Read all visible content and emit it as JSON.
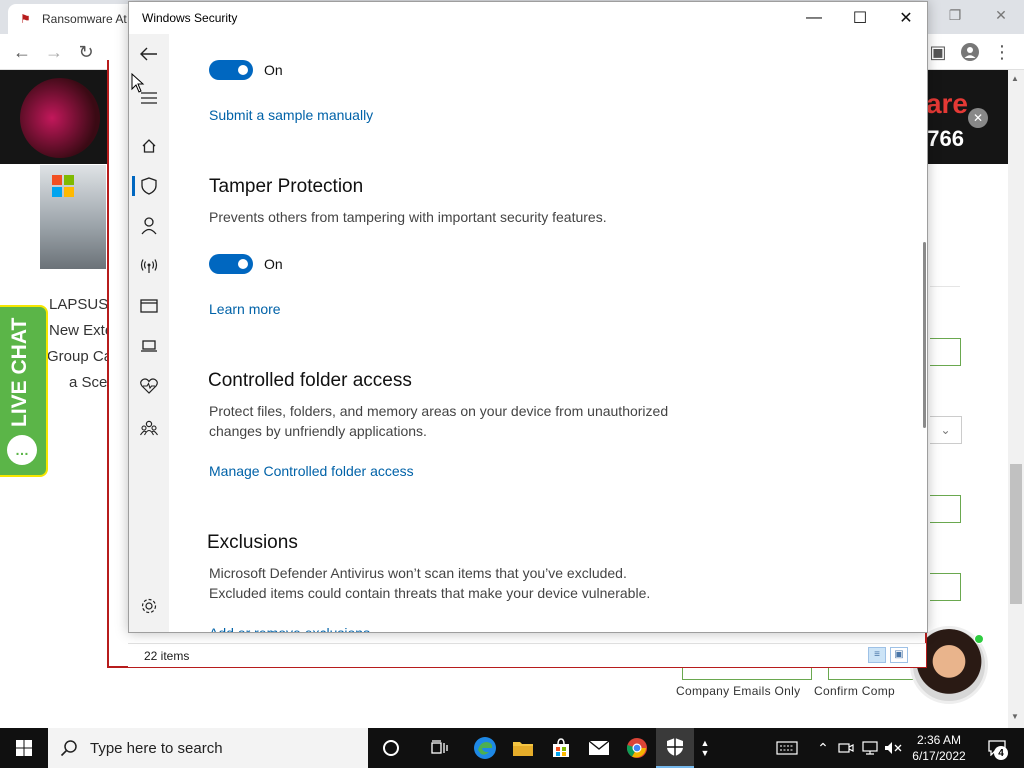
{
  "browser": {
    "tab_title": "Ransomware At",
    "banner_text": "are",
    "banner_number": "766",
    "article_lines": [
      "LAPSUS$",
      "New Exte",
      "Group Ca",
      "a Sce"
    ],
    "live_chat_label": "LIVE CHAT",
    "button_labels": [
      "Company Emails Only",
      "Confirm Comp"
    ]
  },
  "explorer": {
    "item_count": "22 items"
  },
  "security": {
    "window_title": "Windows Security",
    "toggle1_state": "On",
    "submit_sample_link": "Submit a sample manually",
    "tamper": {
      "title": "Tamper Protection",
      "description": "Prevents others from tampering with important security features.",
      "toggle_state": "On",
      "learn_more": "Learn more"
    },
    "cfa": {
      "title": "Controlled folder access",
      "description_line1": "Protect files, folders, and memory areas on your device from unauthorized",
      "description_line2": "changes by unfriendly applications.",
      "link": "Manage Controlled folder access"
    },
    "exclusions": {
      "title": "Exclusions",
      "description_line1": "Microsoft Defender Antivirus won’t scan items that you’ve excluded.",
      "description_line2": "Excluded items could contain threats that make your device vulnerable.",
      "link": "Add or remove exclusions"
    },
    "nav_icons": [
      "back-icon",
      "hamburger-icon",
      "home-icon",
      "shield-icon",
      "account-icon",
      "wireless-icon",
      "app-browser-icon",
      "device-icon",
      "health-icon",
      "family-icon",
      "settings-icon"
    ]
  },
  "taskbar": {
    "search_placeholder": "Type here to search",
    "time": "2:36 AM",
    "date": "6/17/2022",
    "notification_count": "4"
  },
  "colors": {
    "accent": "#0067c0",
    "link": "#0062a8",
    "taskbar": "#101010"
  }
}
